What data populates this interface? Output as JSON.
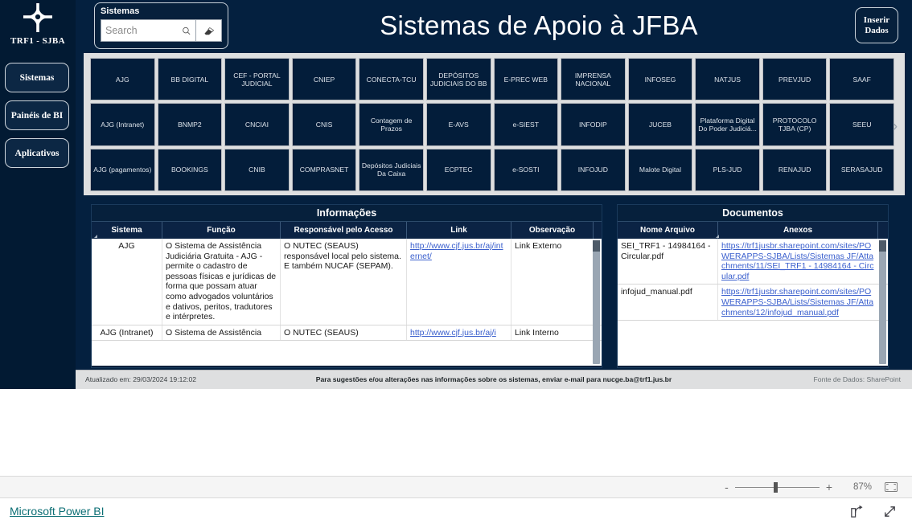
{
  "branding": {
    "logo_icon": "four-point-star-icon",
    "logo_text": "TRF1 - SJBA"
  },
  "header": {
    "title": "Sistemas de Apoio à JFBA",
    "insert_button_label": "Inserir\nDados"
  },
  "slicer": {
    "label": "Sistemas",
    "placeholder": "Search",
    "value": "",
    "search_icon": "search-icon",
    "eraser_icon": "eraser-icon"
  },
  "sidebar": {
    "items": [
      {
        "label": "Sistemas"
      },
      {
        "label": "Painéis de BI"
      },
      {
        "label": "Aplicativos"
      }
    ]
  },
  "tiles": {
    "next_arrow": "›",
    "items": [
      "AJG",
      "BB DIGITAL",
      "CEF - PORTAL JUDICIAL",
      "CNIEP",
      "CONECTA-TCU",
      "DEPÓSITOS JUDICIAIS DO BB",
      "E-PREC WEB",
      "IMPRENSA NACIONAL",
      "INFOSEG",
      "NATJUS",
      "PREVJUD",
      "SAAF",
      "AJG (Intranet)",
      "BNMP2",
      "CNCIAI",
      "CNIS",
      "Contagem de Prazos",
      "E-AVS",
      "e-SIEST",
      "INFODIP",
      "JUCEB",
      "Plataforma Digital Do Poder Judiciá...",
      "PROTOCOLO TJBA (CP)",
      "SEEU",
      "AJG (pagamentos)",
      "BOOKINGS",
      "CNIB",
      "COMPRASNET",
      "Depósitos Judiciais Da Caixa",
      "ECPTEC",
      "e-SOSTI",
      "INFOJUD",
      "Malote Digital",
      "PLS-JUD",
      "RENAJUD",
      "SERASAJUD"
    ]
  },
  "info_table": {
    "title": "Informações",
    "columns": [
      "Sistema",
      "Função",
      "Responsável pelo Acesso",
      "Link",
      "Observação"
    ],
    "rows": [
      {
        "sistema": "AJG",
        "funcao": "O Sistema de Assistência Judiciária Gratuita - AJG - permite o cadastro de pessoas físicas e jurídicas de forma que possam atuar como advogados voluntários e dativos, peritos, tradutores e intérpretes.",
        "responsavel": "O NUTEC (SEAUS) responsável local pelo sistema. E também NUCAF (SEPAM).",
        "link": "http://www.cjf.jus.br/aj/internet/",
        "observacao": "Link Externo"
      },
      {
        "sistema": "AJG (Intranet)",
        "funcao": "O Sistema de Assistência",
        "responsavel": "O NUTEC (SEAUS)",
        "link": "http://www.cjf.jus.br/aj/i",
        "observacao": "Link Interno"
      }
    ]
  },
  "doc_table": {
    "title": "Documentos",
    "columns": [
      "Nome Arquivo",
      "Anexos"
    ],
    "rows": [
      {
        "nome": "SEI_TRF1 - 14984164 - Circular.pdf",
        "anexo": "https://trf1jusbr.sharepoint.com/sites/POWERAPPS-SJBA/Lists/Sistemas JF/Attachments/11/SEI_TRF1 - 14984164 - Circular.pdf"
      },
      {
        "nome": "infojud_manual.pdf",
        "anexo": "https://trf1jusbr.sharepoint.com/sites/POWERAPPS-SJBA/Lists/Sistemas JF/Attachments/12/infojud_manual.pdf"
      }
    ]
  },
  "report_footer": {
    "updated": "Atualizado em: 29/03/2024 19:12:02",
    "message": "Para sugestões e/ou alterações nas informações sobre os sistemas, enviar e-mail para nucge.ba@trf1.jus.br",
    "source": "Fonte de Dados: SharePoint"
  },
  "zoom_bar": {
    "minus": "-",
    "plus": "+",
    "percent": "87%",
    "fit_icon": "fit-to-page-icon"
  },
  "bottom_bar": {
    "brand_link": "Microsoft Power BI",
    "share_icon": "share-icon",
    "fullscreen_icon": "fullscreen-icon"
  },
  "colors": {
    "canvas_dark": "#04203f",
    "rail_dark": "#021a33",
    "tile_dark": "#031d3a",
    "panel_gray": "#dedfe0",
    "link_blue": "#3a5fcd",
    "brand_teal": "#0b6e74"
  }
}
